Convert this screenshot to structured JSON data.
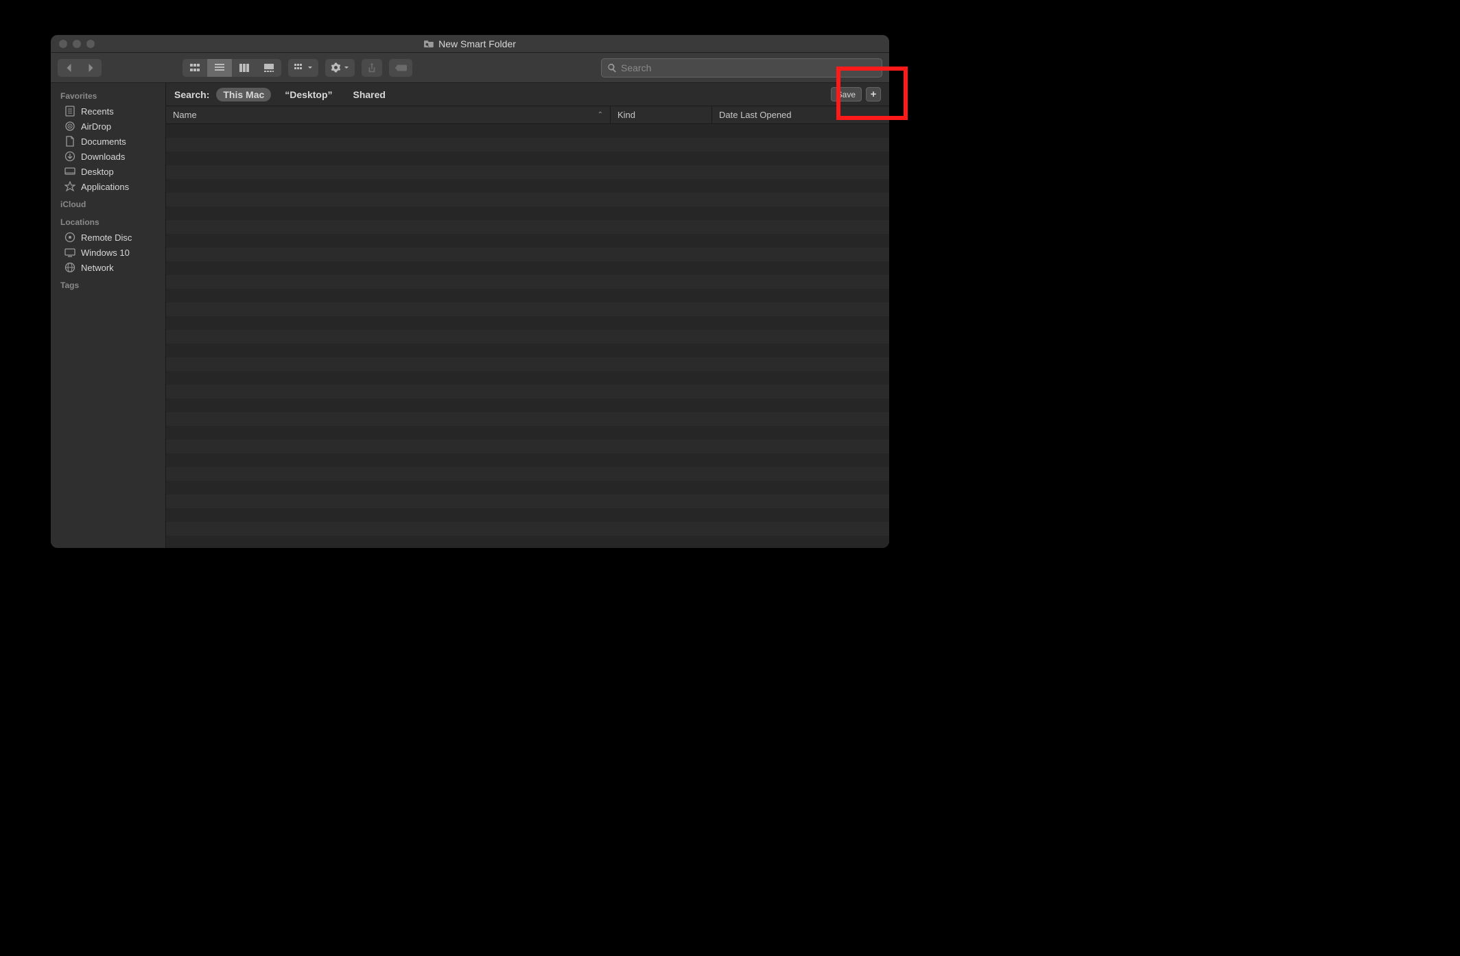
{
  "window": {
    "title": "New Smart Folder"
  },
  "toolbar": {
    "search_placeholder": "Search"
  },
  "sidebar": {
    "sections": [
      {
        "header": "Favorites",
        "items": [
          {
            "label": "Recents",
            "icon": "clock-doc"
          },
          {
            "label": "AirDrop",
            "icon": "airdrop"
          },
          {
            "label": "Documents",
            "icon": "document"
          },
          {
            "label": "Downloads",
            "icon": "download"
          },
          {
            "label": "Desktop",
            "icon": "desktop"
          },
          {
            "label": "Applications",
            "icon": "apps"
          }
        ]
      },
      {
        "header": "iCloud",
        "items": []
      },
      {
        "header": "Locations",
        "items": [
          {
            "label": "Remote Disc",
            "icon": "disc"
          },
          {
            "label": "Windows 10",
            "icon": "display"
          },
          {
            "label": "Network",
            "icon": "globe"
          }
        ]
      },
      {
        "header": "Tags",
        "items": []
      }
    ]
  },
  "scope": {
    "label": "Search:",
    "options": [
      "This Mac",
      "“Desktop”",
      "Shared"
    ],
    "active_index": 0,
    "save_label": "Save",
    "plus_label": "+"
  },
  "columns": {
    "name": "Name",
    "kind": "Kind",
    "date": "Date Last Opened",
    "sort_indicator": "⌃"
  },
  "colors": {
    "highlight": "#ff1a1a"
  }
}
